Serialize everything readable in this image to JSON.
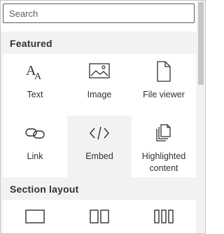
{
  "search": {
    "placeholder": "Search"
  },
  "sections": {
    "featured": {
      "title": "Featured",
      "tiles": [
        {
          "label": "Text",
          "icon": "text-icon"
        },
        {
          "label": "Image",
          "icon": "image-icon"
        },
        {
          "label": "File viewer",
          "icon": "file-icon"
        },
        {
          "label": "Link",
          "icon": "link-icon"
        },
        {
          "label": "Embed",
          "icon": "embed-code-icon",
          "selected": true
        },
        {
          "label": "Highlighted content",
          "icon": "highlighted-content-icon"
        }
      ]
    },
    "section_layout": {
      "title": "Section layout",
      "tiles": [
        {
          "label": "",
          "icon": "one-column-icon"
        },
        {
          "label": "",
          "icon": "two-column-icon"
        },
        {
          "label": "",
          "icon": "three-column-icon"
        }
      ]
    }
  },
  "colors": {
    "panel_bg": "#f3f2f1",
    "tile_bg": "#ffffff",
    "selected_tile_bg": "#f3f2f1",
    "text": "#323130",
    "border": "#c8c6c4"
  }
}
